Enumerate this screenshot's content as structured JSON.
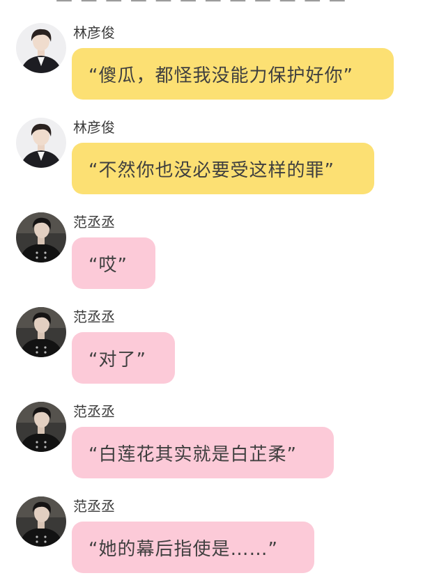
{
  "colors": {
    "yellow_bubble": "#fce073",
    "pink_bubble": "#fccad8",
    "text": "#3f3f3f",
    "sender_text": "#3a3a3a",
    "background": "#ffffff"
  },
  "messages": [
    {
      "sender": "林彦俊",
      "avatar": "male-portrait-light-suit-avatar",
      "bubble_color": "yellow",
      "text": "“傻瓜，都怪我没能力保护好你”"
    },
    {
      "sender": "林彦俊",
      "avatar": "male-portrait-light-suit-avatar",
      "bubble_color": "yellow",
      "text": "“不然你也没必要受这样的罪”"
    },
    {
      "sender": "范丞丞",
      "avatar": "male-portrait-dark-uniform-avatar",
      "bubble_color": "pink",
      "text": "“哎”"
    },
    {
      "sender": "范丞丞",
      "avatar": "male-portrait-dark-uniform-avatar",
      "bubble_color": "pink",
      "text": "“对了”"
    },
    {
      "sender": "范丞丞",
      "avatar": "male-portrait-dark-uniform-avatar",
      "bubble_color": "pink",
      "text": "“白莲花其实就是白芷柔”"
    },
    {
      "sender": "范丞丞",
      "avatar": "male-portrait-dark-uniform-avatar",
      "bubble_color": "pink",
      "text": "“她的幕后指使是……”"
    }
  ]
}
